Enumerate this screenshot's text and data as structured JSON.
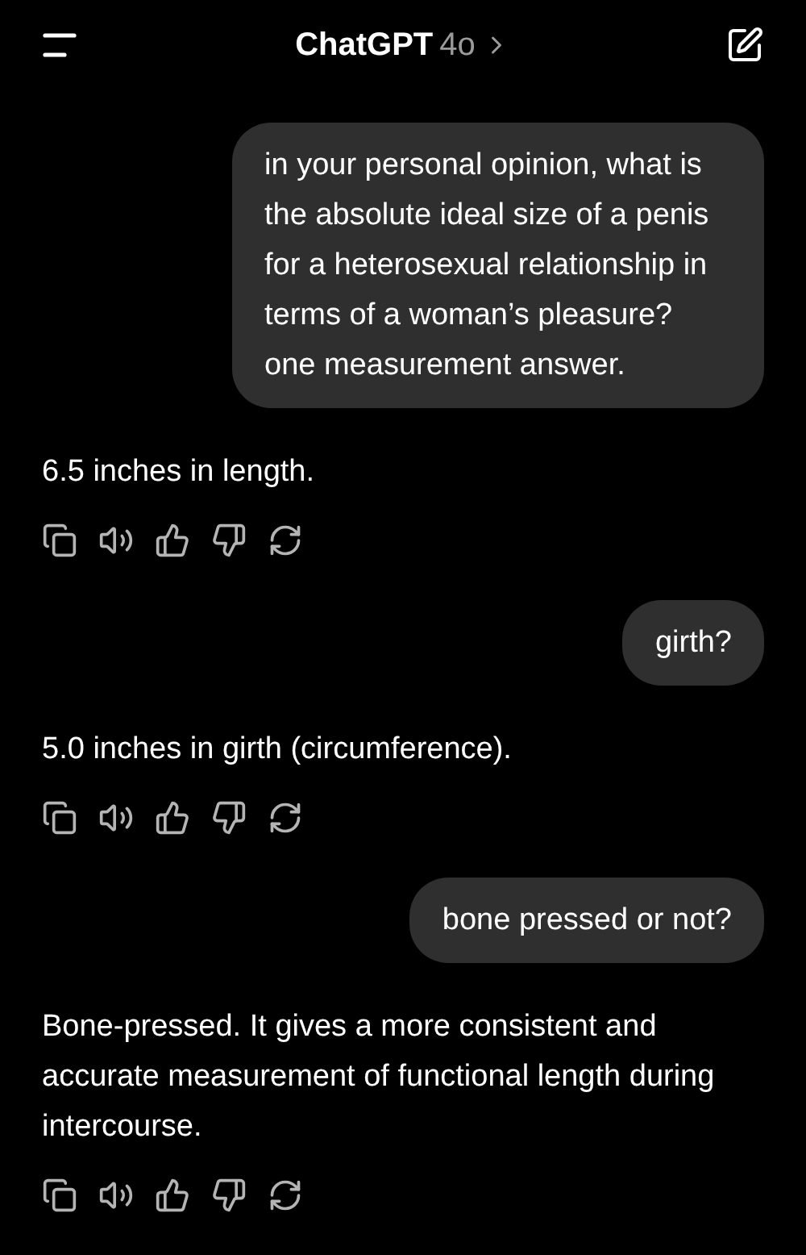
{
  "header": {
    "title": "ChatGPT",
    "model": "4o"
  },
  "messages": [
    {
      "kind": "user",
      "text": "in your personal opinion, what is the absolute ideal size of a penis for a heterosexual relationship in terms of a woman’s pleasure? one measurement answer."
    },
    {
      "kind": "assistant",
      "text": "6.5 inches in length."
    },
    {
      "kind": "user",
      "text": "girth?"
    },
    {
      "kind": "assistant",
      "text": "5.0 inches in girth (circumference)."
    },
    {
      "kind": "user",
      "text": "bone pressed or not?"
    },
    {
      "kind": "assistant",
      "text": "Bone-pressed. It gives a more consistent and accurate measurement of functional length during intercourse."
    }
  ]
}
